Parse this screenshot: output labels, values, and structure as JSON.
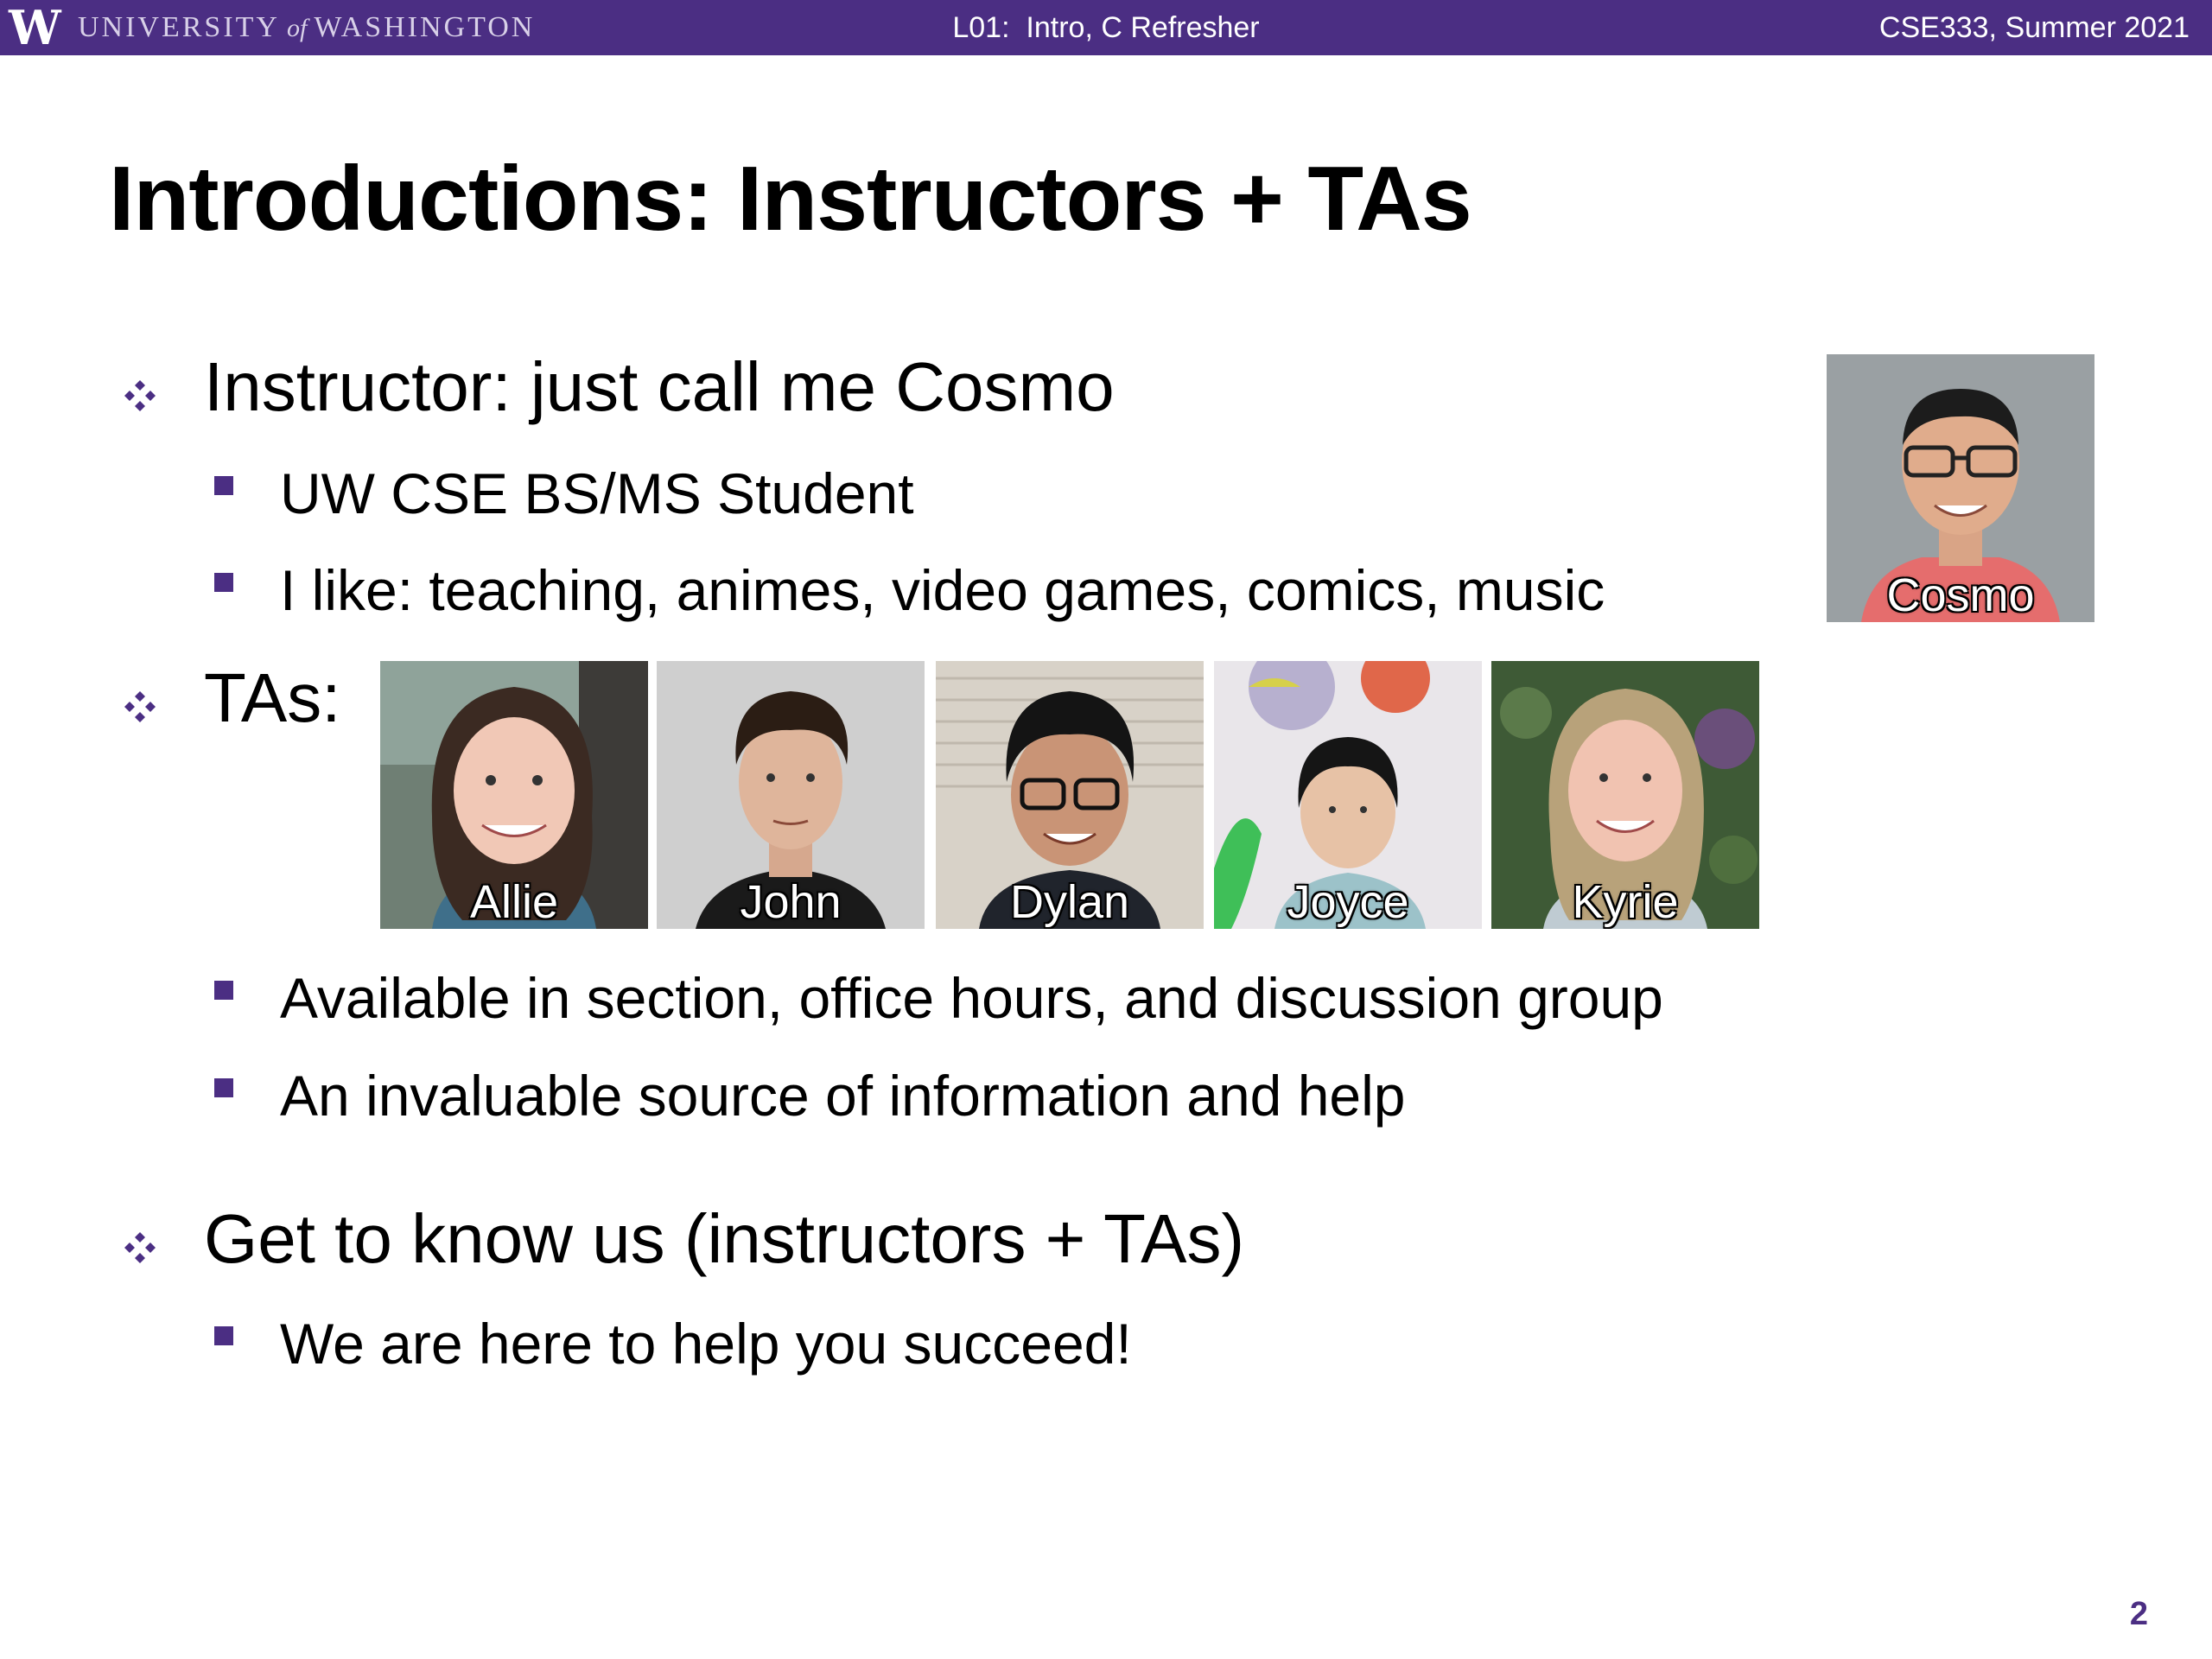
{
  "header": {
    "logo_letter": "W",
    "university_left": "UNIVERSITY",
    "university_of": "of",
    "university_right": "WASHINGTON",
    "lecture": "L01:  Intro, C Refresher",
    "course": "CSE333, Summer 2021",
    "colors": {
      "bar": "#4b2e83",
      "accent": "#4b2e83"
    }
  },
  "title": "Introductions: Instructors + TAs",
  "sections": {
    "instructor": {
      "text": "Instructor: just call me Cosmo",
      "subs": [
        "UW CSE BS/MS Student",
        "I like:  teaching, animes, video games, comics, music"
      ],
      "photo_caption": "Cosmo"
    },
    "tas": {
      "text": "TAs:",
      "photos": [
        "Allie",
        "John",
        "Dylan",
        "Joyce",
        "Kyrie"
      ],
      "subs": [
        "Available in section, office hours, and discussion group",
        "An invaluable source of information and help"
      ]
    },
    "know": {
      "text": "Get to know us (instructors + TAs)",
      "subs": [
        "We are here to help you succeed!"
      ]
    }
  },
  "page_number": "2",
  "icons": {
    "level1_bullet": "four-diamond-icon",
    "level2_bullet": "square-icon"
  }
}
